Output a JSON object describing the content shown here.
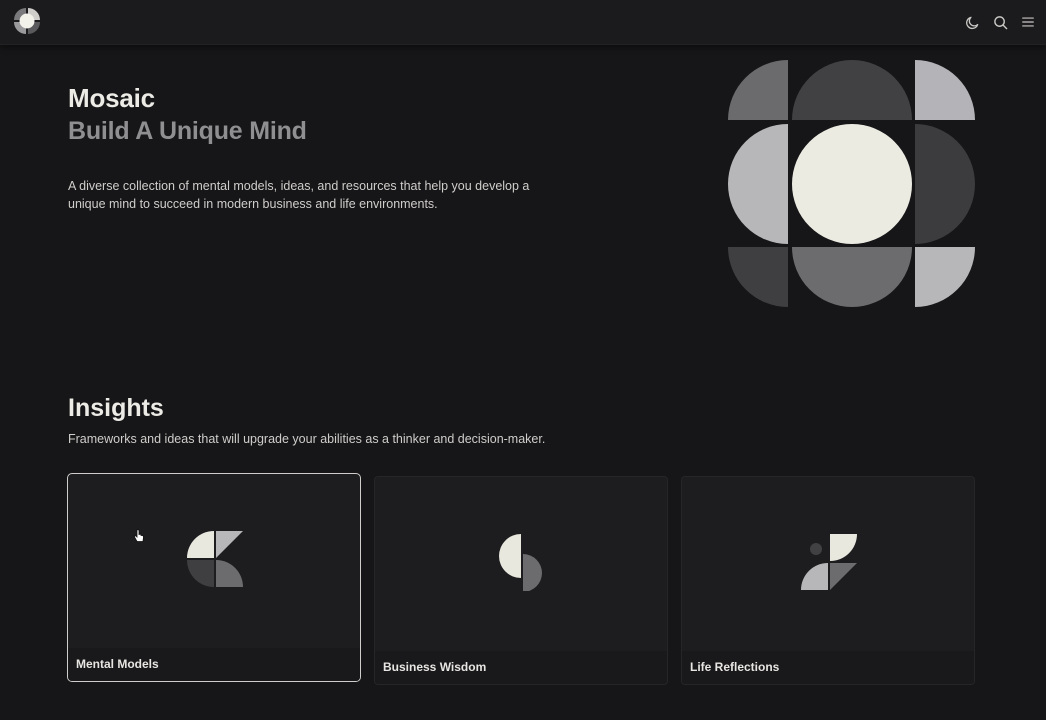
{
  "header": {
    "logo_icon": "mosaic-logo-icon",
    "actions": [
      {
        "icon": "moon-icon",
        "name": "theme-toggle"
      },
      {
        "icon": "search-icon",
        "name": "search"
      },
      {
        "icon": "menu-icon",
        "name": "menu"
      }
    ]
  },
  "hero": {
    "title": "Mosaic",
    "subtitle": "Build A Unique Mind",
    "description": "A diverse collection of mental models, ideas, and resources that help you develop a unique mind to succeed in modern business and life environments."
  },
  "insights": {
    "title": "Insights",
    "description": "Frameworks and ideas that will upgrade your abilities as a thinker and decision-maker.",
    "cards": [
      {
        "label": "Mental Models",
        "selected": true
      },
      {
        "label": "Business Wisdom",
        "selected": false
      },
      {
        "label": "Life Reflections",
        "selected": false
      }
    ]
  },
  "colors": {
    "background": "#161517",
    "cream": "#ecebe2",
    "light_gray": "#b7b6b9",
    "mid_gray": "#6c6b6e",
    "dark_gray": "#3f3e41",
    "muted_text": "#8f8e91"
  }
}
